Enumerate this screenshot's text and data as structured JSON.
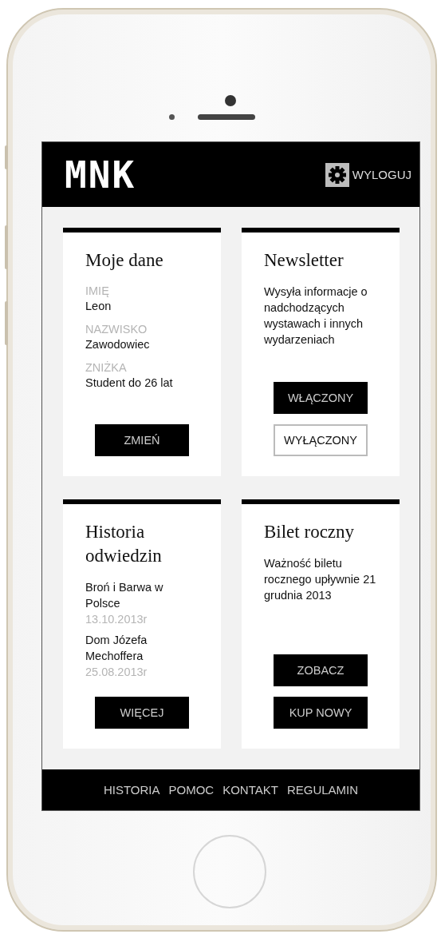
{
  "header": {
    "logo": "MNK",
    "logout": "WYLOGUJ"
  },
  "cards": [
    {
      "kind": "profile",
      "title": "Moje dane",
      "fields": [
        {
          "label": "IMIĘ",
          "value": "Leon"
        },
        {
          "label": "NAZWISKO",
          "value": "Zawodowiec"
        },
        {
          "label": "ZNIŻKA",
          "value": "Student do 26 lat"
        }
      ],
      "buttons": [
        {
          "label": "ZMIEŃ",
          "selected": false
        }
      ]
    },
    {
      "kind": "toggle",
      "title": "Newsletter",
      "text": "Wysyła informacje o nadchodzących wystawach i innych wydarzeniach",
      "buttons": [
        {
          "label": "WŁĄCZONY",
          "selected": false
        },
        {
          "label": "WYŁĄCZONY",
          "selected": true
        }
      ]
    },
    {
      "kind": "history",
      "title": "Historia odwiedzin",
      "visits": [
        {
          "name": "Broń i Barwa w Polsce",
          "date": "13.10.2013r"
        },
        {
          "name": "Dom Józefa Mechoffera",
          "date": "25.08.2013r"
        }
      ],
      "buttons": [
        {
          "label": "WIĘCEJ",
          "selected": false
        }
      ]
    },
    {
      "kind": "ticket",
      "title": "Bilet roczny",
      "text": "Ważność biletu rocznego upływnie 21 grudnia 2013",
      "buttons": [
        {
          "label": "ZOBACZ",
          "selected": false
        },
        {
          "label": "KUP NOWY",
          "selected": false
        }
      ]
    }
  ],
  "footer": {
    "links": [
      "HISTORIA",
      "POMOC",
      "KONTAKT",
      "REGULAMIN"
    ]
  }
}
